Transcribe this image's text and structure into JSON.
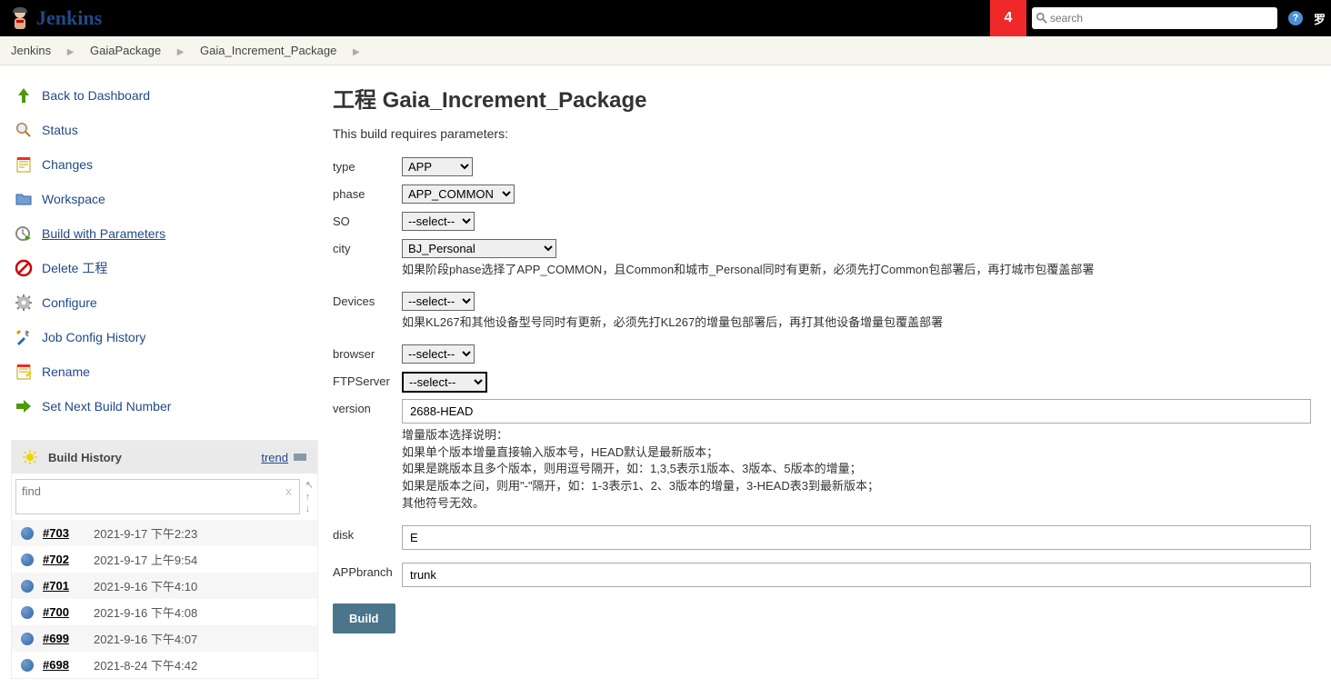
{
  "header": {
    "brand": "Jenkins",
    "notif_count": "4",
    "search_placeholder": "search",
    "user_short": "罗"
  },
  "breadcrumb": [
    "Jenkins",
    "GaiaPackage",
    "Gaia_Increment_Package"
  ],
  "side_tasks": [
    {
      "key": "back-dashboard",
      "label": "Back to Dashboard"
    },
    {
      "key": "status",
      "label": "Status"
    },
    {
      "key": "changes",
      "label": "Changes"
    },
    {
      "key": "workspace",
      "label": "Workspace"
    },
    {
      "key": "build-params",
      "label": "Build with Parameters",
      "active": true
    },
    {
      "key": "delete",
      "label": "Delete 工程"
    },
    {
      "key": "configure",
      "label": "Configure"
    },
    {
      "key": "job-config-hist",
      "label": "Job Config History"
    },
    {
      "key": "rename",
      "label": "Rename"
    },
    {
      "key": "set-next-build",
      "label": "Set Next Build Number"
    }
  ],
  "build_history": {
    "title": "Build History",
    "trend_label": "trend",
    "find_placeholder": "find",
    "builds": [
      {
        "num": "#703",
        "ts": "2021-9-17 下午2:23"
      },
      {
        "num": "#702",
        "ts": "2021-9-17 上午9:54"
      },
      {
        "num": "#701",
        "ts": "2021-9-16 下午4:10"
      },
      {
        "num": "#700",
        "ts": "2021-9-16 下午4:08"
      },
      {
        "num": "#699",
        "ts": "2021-9-16 下午4:07"
      },
      {
        "num": "#698",
        "ts": "2021-8-24 下午4:42"
      }
    ]
  },
  "main": {
    "title": "工程 Gaia_Increment_Package",
    "subtitle": "This build requires parameters:",
    "params": {
      "type": {
        "label": "type",
        "value": "APP"
      },
      "phase": {
        "label": "phase",
        "value": "APP_COMMON"
      },
      "SO": {
        "label": "SO",
        "value": "--select--"
      },
      "city": {
        "label": "city",
        "value": "BJ_Personal",
        "help": "如果阶段phase选择了APP_COMMON，且Common和城市_Personal同时有更新，必须先打Common包部署后，再打城市包覆盖部署"
      },
      "Devices": {
        "label": "Devices",
        "value": "--select--",
        "help": "如果KL267和其他设备型号同时有更新，必须先打KL267的增量包部署后，再打其他设备增量包覆盖部署"
      },
      "browser": {
        "label": "browser",
        "value": "--select--"
      },
      "FTPServer": {
        "label": "FTPServer",
        "value": "--select--"
      },
      "version": {
        "label": "version",
        "value": "2688-HEAD",
        "help": "增量版本选择说明：\n如果单个版本增量直接输入版本号，HEAD默认是最新版本；\n如果是跳版本且多个版本，则用逗号隔开，如：1,3,5表示1版本、3版本、5版本的增量；\n如果是版本之间，则用\"-\"隔开，如：1-3表示1、2、3版本的增量，3-HEAD表3到最新版本；\n其他符号无效。"
      },
      "disk": {
        "label": "disk",
        "value": "E"
      },
      "APPbranch": {
        "label": "APPbranch",
        "value": "trunk"
      }
    },
    "build_button": "Build"
  }
}
